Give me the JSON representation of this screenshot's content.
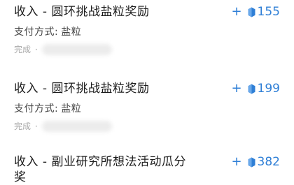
{
  "transactions": [
    {
      "title": "收入 - 圆环挑战盐粒奖励",
      "plus": "+",
      "amount": "155",
      "method_label": "支付方式:",
      "method_value": "盐粒",
      "status": "完成",
      "separator": "·"
    },
    {
      "title": "收入 - 圆环挑战盐粒奖励",
      "plus": "+",
      "amount": "199",
      "method_label": "支付方式:",
      "method_value": "盐粒",
      "status": "完成",
      "separator": "·"
    },
    {
      "title": "收入 - 副业研究所想法活动瓜分奖",
      "plus": "+",
      "amount": "382"
    }
  ],
  "colors": {
    "amount": "#2f7fd6",
    "status": "#a9a9a9"
  },
  "icons": {
    "coin": "salt-grain-icon"
  }
}
